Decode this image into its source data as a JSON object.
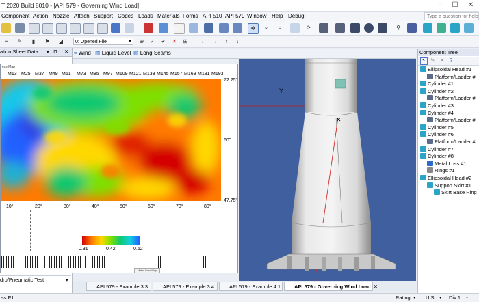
{
  "window": {
    "title": "T 2020 Build 8010 - [API 579 - Governing Wind Load]",
    "controls": [
      "–",
      "☐",
      "✕"
    ]
  },
  "menu": {
    "items": [
      "Component",
      "Action",
      "Nozzle",
      "Attach",
      "Support",
      "Codes",
      "Loads",
      "Materials",
      "Forms",
      "API 510",
      "API 579",
      "Window",
      "Help",
      "Debug"
    ],
    "help_placeholder": "Type a question for help"
  },
  "toolbar": {
    "opened_file": "0: Opened File"
  },
  "left_panel": {
    "title": "ation Sheet Data",
    "bottom_label": "dro/Pneumatic Test"
  },
  "view_bar": {
    "wind": "Wind",
    "liquid_level": "Liquid Level",
    "long_seams": "Long Seams"
  },
  "map": {
    "title": "ess Map",
    "columns": [
      "M13",
      "M25",
      "M37",
      "M49",
      "M61",
      "M73",
      "M85",
      "M97",
      "M109",
      "M121",
      "M133",
      "M145",
      "M157",
      "M169",
      "M181",
      "M193"
    ],
    "y_labels": [
      "72.25\"",
      "60\"",
      "47.75\""
    ],
    "x_labels": [
      "10°",
      "20°",
      "30°",
      "40°",
      "50°",
      "60°",
      "70°",
      "80°"
    ],
    "legend_values": [
      "0.31",
      "0.42",
      "0.52"
    ],
    "legend_colors": [
      "#d40000",
      "#ff7a00",
      "#ffd800",
      "#7ee000",
      "#10c870",
      "#10d0e0",
      "#2060ff"
    ],
    "footer_label": "Metal Loss Map"
  },
  "viewport": {
    "axis_label": "Y"
  },
  "component_tree": {
    "title": "Component Tree",
    "items": [
      {
        "label": "Ellipsoidal Head #1",
        "level": 0
      },
      {
        "label": "Platform/Ladder #",
        "level": 1
      },
      {
        "label": "Cylinder #1",
        "level": 0
      },
      {
        "label": "Cylinder #2",
        "level": 0
      },
      {
        "label": "Platform/Ladder #",
        "level": 1
      },
      {
        "label": "Cylinder #3",
        "level": 0
      },
      {
        "label": "Cylinder #4",
        "level": 0
      },
      {
        "label": "Platform/Ladder #",
        "level": 1
      },
      {
        "label": "Cylinder #5",
        "level": 0
      },
      {
        "label": "Cylinder #6",
        "level": 0
      },
      {
        "label": "Platform/Ladder #",
        "level": 1
      },
      {
        "label": "Cylinder #7",
        "level": 0
      },
      {
        "label": "Cylinder #8",
        "level": 0
      },
      {
        "label": "Metal Loss #1",
        "level": 1
      },
      {
        "label": "Rings #1",
        "level": 1
      },
      {
        "label": "Ellipsoidal Head #2",
        "level": 0
      },
      {
        "label": "Support Skirt #1",
        "level": 1
      },
      {
        "label": "Skirt Base Ring",
        "level": 2
      }
    ]
  },
  "tabs": [
    {
      "label": "API 579 - Example 3.3"
    },
    {
      "label": "API 579 - Example 3.4"
    },
    {
      "label": "API 579 - Example 4.1"
    },
    {
      "label": "API 579 - Governing Wind Load"
    }
  ],
  "status": {
    "left": "ss F1",
    "rating": "Rating",
    "units": "U.S.",
    "div": "Div 1"
  }
}
